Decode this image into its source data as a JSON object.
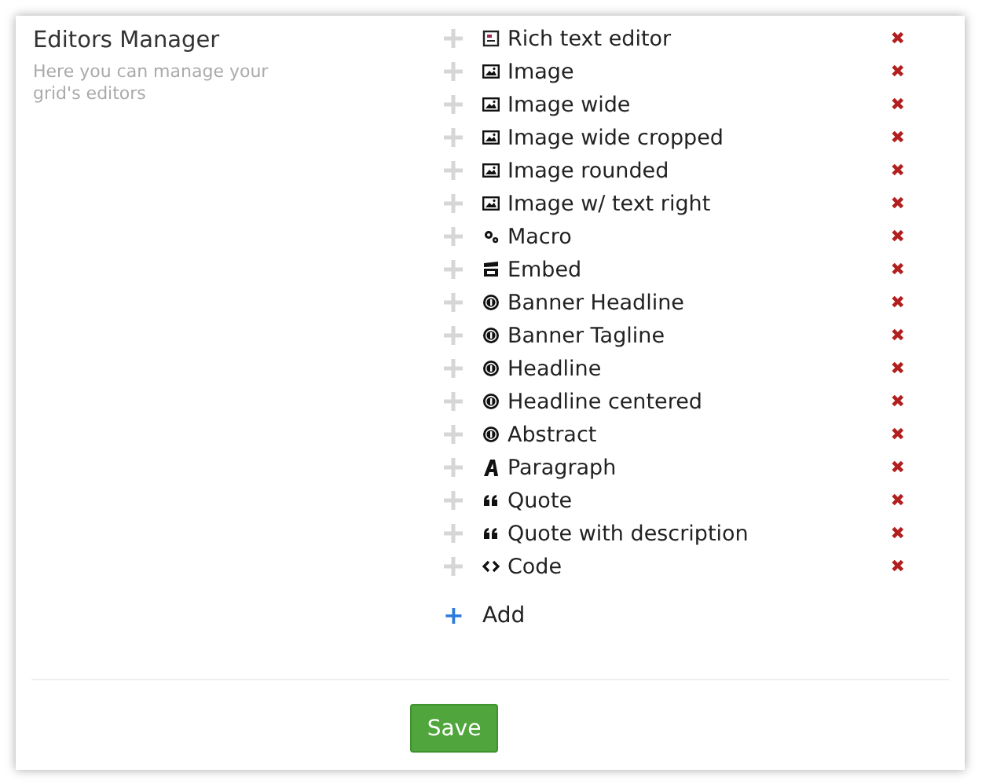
{
  "section": {
    "title": "Editors Manager",
    "description": "Here you can manage your grid's editors"
  },
  "editors": [
    {
      "name": "Rich text editor",
      "kind": "richtext"
    },
    {
      "name": "Image",
      "kind": "image"
    },
    {
      "name": "Image wide",
      "kind": "image"
    },
    {
      "name": "Image wide cropped",
      "kind": "image"
    },
    {
      "name": "Image rounded",
      "kind": "image"
    },
    {
      "name": "Image w/ text right",
      "kind": "image"
    },
    {
      "name": "Macro",
      "kind": "macro"
    },
    {
      "name": "Embed",
      "kind": "embed"
    },
    {
      "name": "Banner Headline",
      "kind": "headline"
    },
    {
      "name": "Banner Tagline",
      "kind": "headline"
    },
    {
      "name": "Headline",
      "kind": "headline"
    },
    {
      "name": "Headline centered",
      "kind": "headline"
    },
    {
      "name": "Abstract",
      "kind": "headline"
    },
    {
      "name": "Paragraph",
      "kind": "paragraph"
    },
    {
      "name": "Quote",
      "kind": "quote"
    },
    {
      "name": "Quote with description",
      "kind": "quote"
    },
    {
      "name": "Code",
      "kind": "code"
    }
  ],
  "add": {
    "icon": "+",
    "label": "Add"
  },
  "remove_icon": "✖",
  "save": "Save"
}
